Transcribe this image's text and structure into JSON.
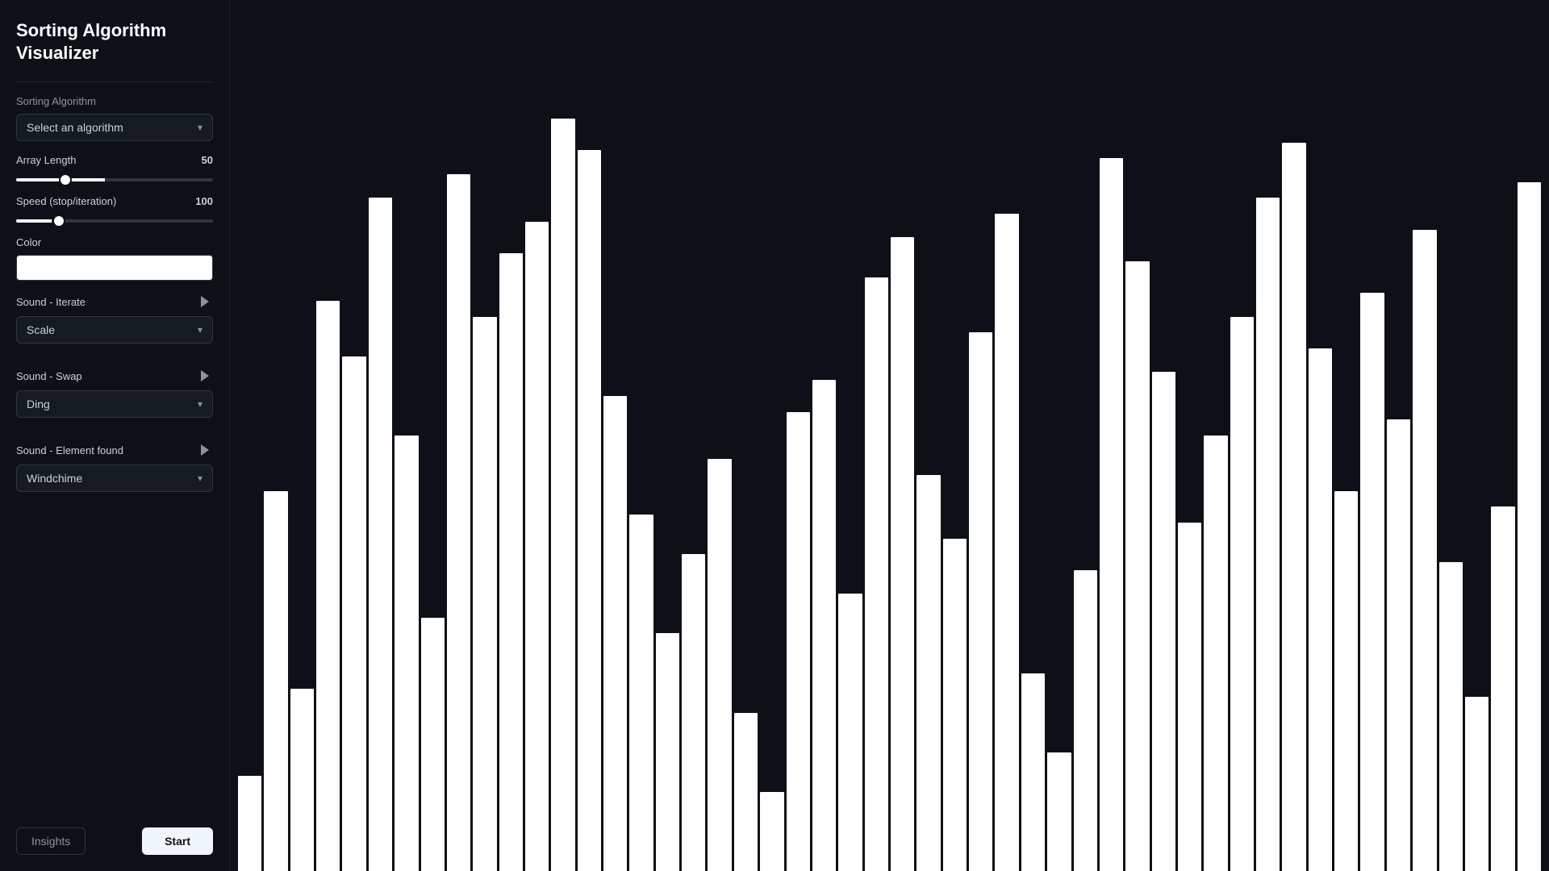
{
  "app": {
    "title_line1": "Sorting Algorithm",
    "title_line2": "Visualizer"
  },
  "sidebar": {
    "sorting_algorithm_label": "Sorting Algorithm",
    "algorithm_placeholder": "Select an algorithm",
    "array_length_label": "Array Length",
    "array_length_value": "50",
    "array_length_min": 5,
    "array_length_max": 200,
    "array_length_current": 50,
    "speed_label": "Speed (stop/iteration)",
    "speed_value": "100",
    "speed_min": 1,
    "speed_max": 500,
    "speed_current": 100,
    "color_label": "Color",
    "sound_iterate_label": "Sound - Iterate",
    "sound_iterate_option": "Scale",
    "sound_swap_label": "Sound - Swap",
    "sound_swap_option": "Ding",
    "sound_element_label": "Sound - Element found",
    "sound_element_option": "Windchime",
    "insights_button": "Insights",
    "start_button": "Start"
  },
  "bars": [
    12,
    48,
    23,
    72,
    65,
    85,
    55,
    32,
    88,
    70,
    78,
    82,
    95,
    91,
    60,
    45,
    30,
    40,
    52,
    20,
    10,
    58,
    62,
    35,
    75,
    80,
    50,
    42,
    68,
    83,
    25,
    15,
    38,
    90,
    77,
    63,
    44,
    55,
    70,
    85,
    92,
    66,
    48,
    73,
    57,
    81,
    39,
    22,
    46,
    87
  ]
}
